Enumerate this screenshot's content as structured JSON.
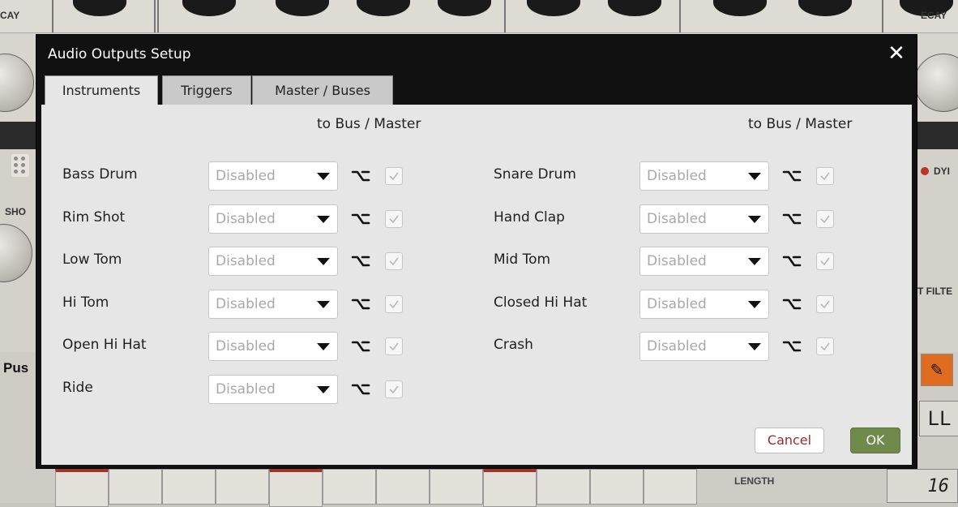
{
  "background": {
    "labels": {
      "decay_left": "CAY",
      "decay_right": "ECAY",
      "rim_shot": "SHO",
      "dyn": "DYI",
      "filter": "T FILTE",
      "push": "Pus",
      "length": "LENGTH",
      "lcd_top": "LL",
      "lcd_length": "16"
    }
  },
  "dialog": {
    "title": "Audio Outputs Setup",
    "close_label": "✕",
    "tabs": [
      {
        "label": "Instruments",
        "active": true
      },
      {
        "label": "Triggers",
        "active": false
      },
      {
        "label": "Master / Buses",
        "active": false
      }
    ],
    "column_header_left": "to Bus / Master",
    "column_header_right": "to Bus / Master",
    "left_rows": [
      {
        "label": "Bass Drum",
        "value": "Disabled"
      },
      {
        "label": "Rim Shot",
        "value": "Disabled"
      },
      {
        "label": "Low Tom",
        "value": "Disabled"
      },
      {
        "label": "Hi Tom",
        "value": "Disabled"
      },
      {
        "label": "Open Hi Hat",
        "value": "Disabled"
      },
      {
        "label": "Ride",
        "value": "Disabled"
      }
    ],
    "right_rows": [
      {
        "label": "Snare Drum",
        "value": "Disabled"
      },
      {
        "label": "Hand Clap",
        "value": "Disabled"
      },
      {
        "label": "Mid Tom",
        "value": "Disabled"
      },
      {
        "label": "Closed Hi Hat",
        "value": "Disabled"
      },
      {
        "label": "Crash",
        "value": "Disabled"
      }
    ],
    "cancel_label": "Cancel",
    "ok_label": "OK"
  },
  "colors": {
    "dialog_bg": "#111111",
    "panel_bg": "#e6e6e6",
    "ok_green": "#6f8a4b",
    "cancel_text": "#9b2a2a",
    "pencil_orange": "#e06c1f"
  }
}
